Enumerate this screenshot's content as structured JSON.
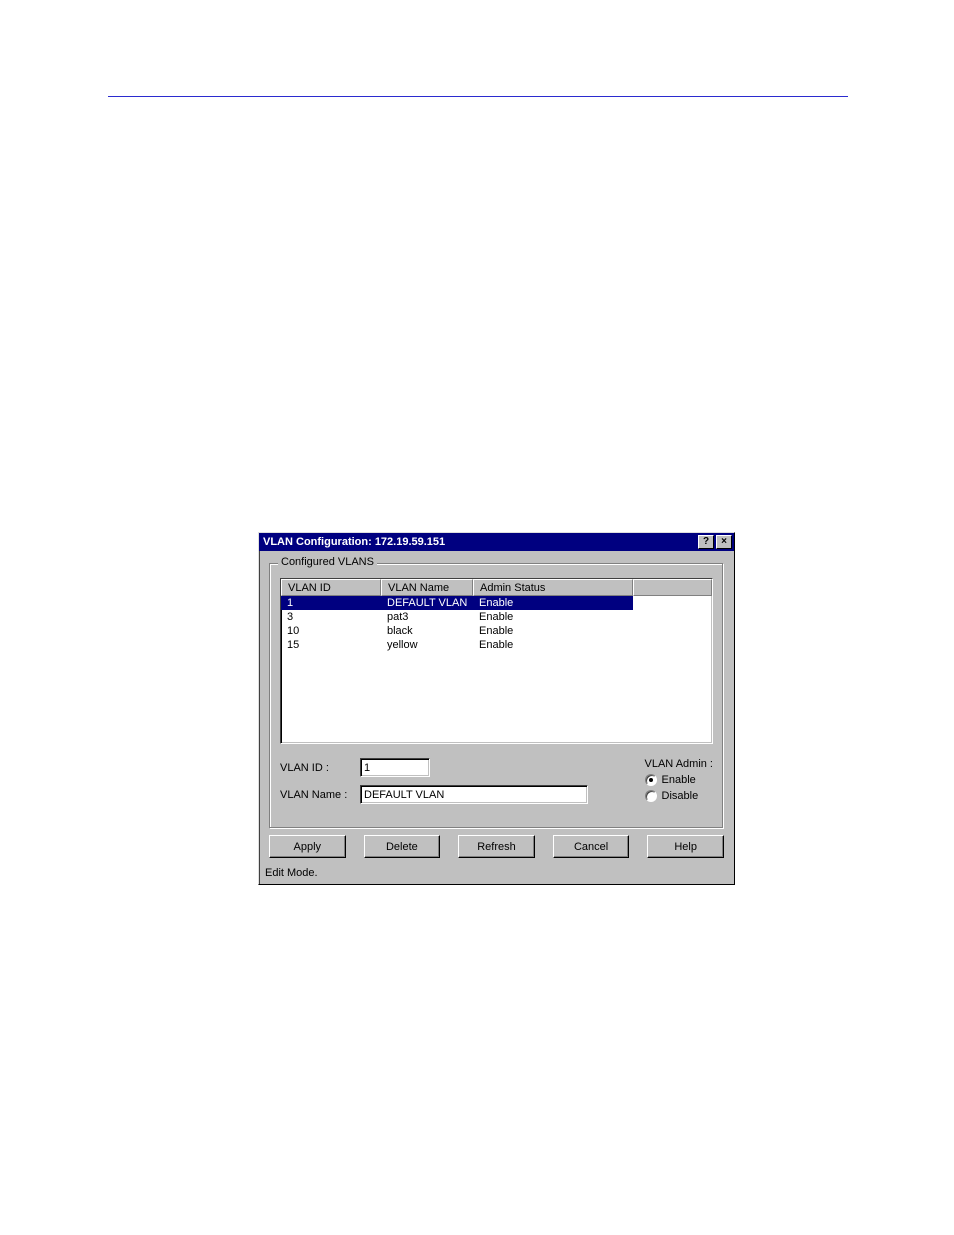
{
  "dialog": {
    "title": "VLAN Configuration: 172.19.59.151",
    "help_btn": "?",
    "close_btn": "×"
  },
  "group": {
    "label": "Configured VLANS"
  },
  "columns": {
    "id": "VLAN ID",
    "name": "VLAN Name",
    "status": "Admin Status"
  },
  "rows": [
    {
      "id": "1",
      "name": "DEFAULT VLAN",
      "status": "Enable",
      "selected": true
    },
    {
      "id": "3",
      "name": "pat3",
      "status": "Enable",
      "selected": false
    },
    {
      "id": "10",
      "name": "black",
      "status": "Enable",
      "selected": false
    },
    {
      "id": "15",
      "name": "yellow",
      "status": "Enable",
      "selected": false
    }
  ],
  "form": {
    "vlan_id_label": "VLAN ID :",
    "vlan_id_value": "1",
    "vlan_name_label": "VLAN Name :",
    "vlan_name_value": "DEFAULT VLAN",
    "admin_label": "VLAN Admin :",
    "enable_label": "Enable",
    "disable_label": "Disable"
  },
  "buttons": {
    "apply": "Apply",
    "delete": "Delete",
    "refresh": "Refresh",
    "cancel": "Cancel",
    "help": "Help"
  },
  "status": "Edit Mode."
}
